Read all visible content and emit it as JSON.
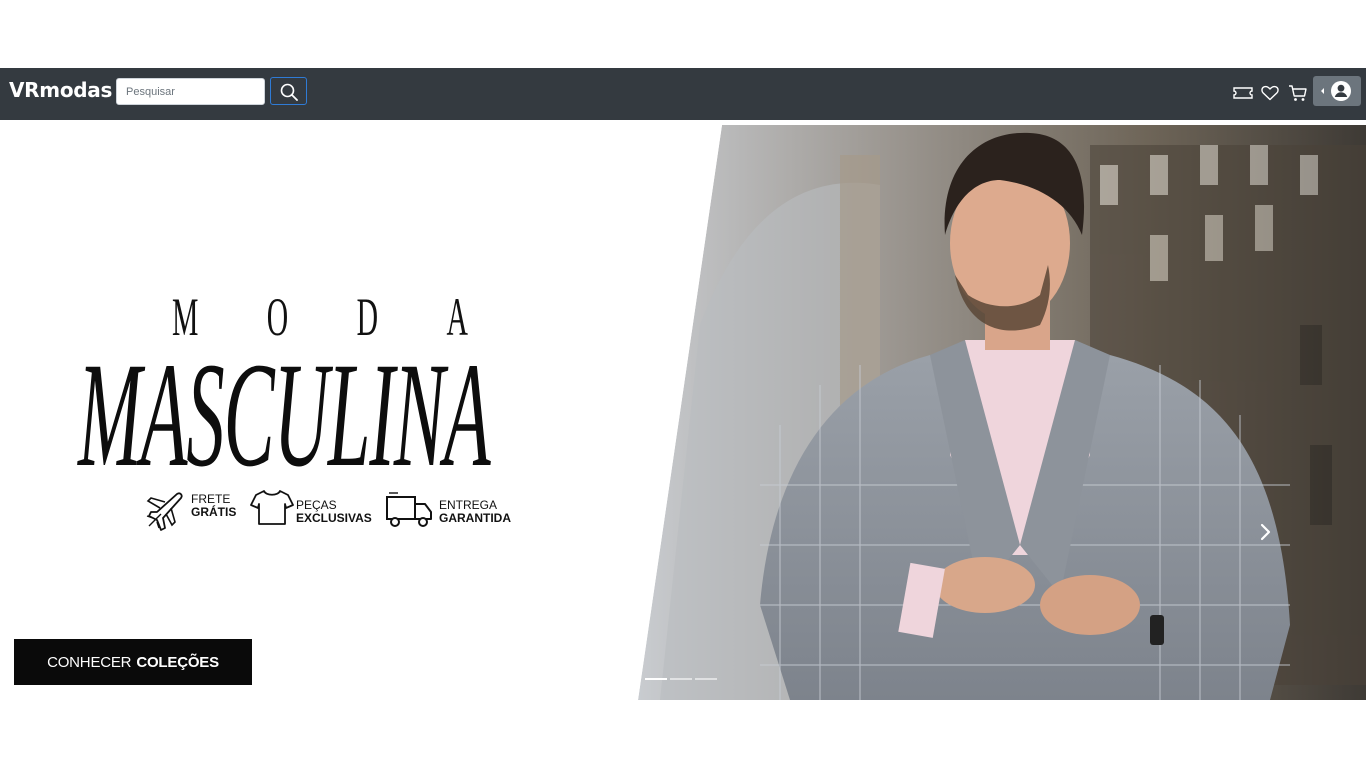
{
  "navbar": {
    "brand": "VRmodas",
    "search": {
      "placeholder": "Pesquisar",
      "value": ""
    },
    "icons": [
      "ticket-icon",
      "heart-icon",
      "cart-icon",
      "user-avatar-icon"
    ]
  },
  "hero": {
    "eyebrow_letters": [
      "M",
      "O",
      "D",
      "A"
    ],
    "title": "MASCULINA",
    "features": [
      {
        "icon": "airplane-icon",
        "line1": "FRETE",
        "line2": "GRÁTIS"
      },
      {
        "icon": "tshirt-icon",
        "line1": "PEÇAS",
        "line2": "EXCLUSIVAS"
      },
      {
        "icon": "truck-icon",
        "line1": "ENTREGA",
        "line2": "GARANTIDA"
      }
    ],
    "cta": {
      "normal": "CONHECER",
      "bold": "COLEÇÕES"
    }
  },
  "carousel": {
    "slides": 3,
    "active_slide": 1
  },
  "colors": {
    "navbar_bg": "#343a40",
    "search_button_border": "#2f7bd6",
    "user_button_bg": "#6c757d",
    "cta_bg": "#0a0a0a"
  }
}
